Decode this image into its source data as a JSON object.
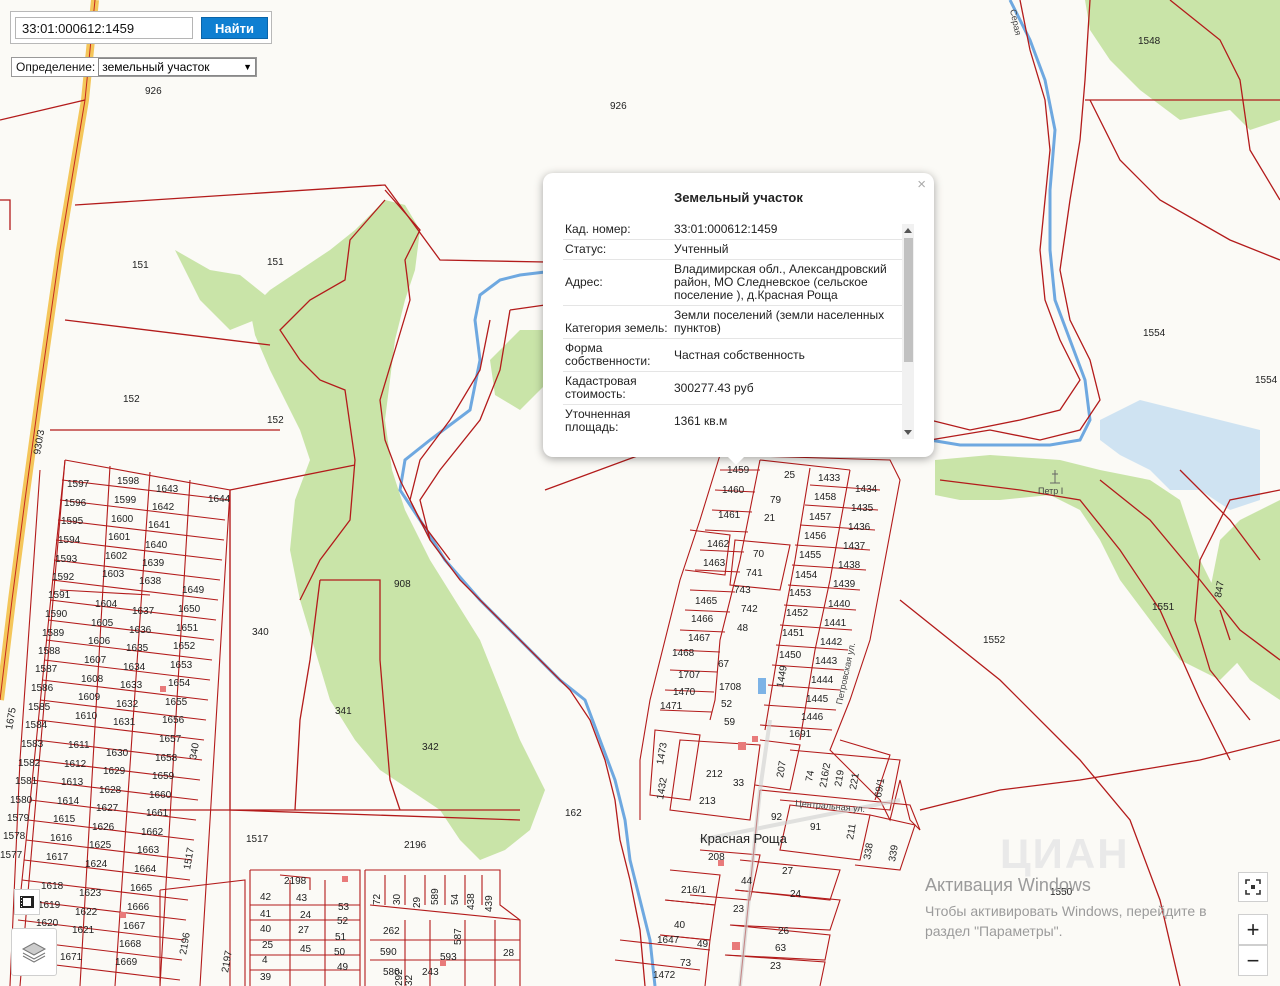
{
  "search": {
    "value": "33:01:000612:1459",
    "button_label": "Найти"
  },
  "definition": {
    "label": "Определение:",
    "selected": "земельный участок"
  },
  "popup": {
    "title": "Земельный участок",
    "close": "×",
    "fields": [
      {
        "key": "Кад. номер:",
        "value": "33:01:000612:1459"
      },
      {
        "key": "Статус:",
        "value": "Учтенный"
      },
      {
        "key": "Адрес:",
        "value": "Владимирская обл., Александровский район, МО Следневское (сельское поселение ), д.Красная Роща"
      },
      {
        "key": "Категория земель:",
        "value": "Земли поселений (земли населенных пунктов)"
      },
      {
        "key": "Форма собственности:",
        "value": "Частная собственность"
      },
      {
        "key": "Кадастровая стоимость:",
        "value": "300277.43 руб"
      },
      {
        "key": "Уточненная площадь:",
        "value": "1361 кв.м"
      }
    ]
  },
  "map": {
    "place_name": "Красная Роща",
    "streets": [
      "Петровская ул.",
      "Центральная ул.",
      "Серая"
    ],
    "parcel_labels": [
      "926",
      "926",
      "1548",
      "151",
      "151",
      "152",
      "152",
      "1554",
      "1554",
      "908",
      "340",
      "341",
      "342",
      "162",
      "1517",
      "2196",
      "2198",
      "1552",
      "1551",
      "847",
      "930/3",
      "1597",
      "1598",
      "1643",
      "1644",
      "1596",
      "1599",
      "1642",
      "1595",
      "1600",
      "1641",
      "1594",
      "1601",
      "1640",
      "1593",
      "1602",
      "1639",
      "1592",
      "1603",
      "1638",
      "1649",
      "1591",
      "1604",
      "1637",
      "1650",
      "1590",
      "1605",
      "1636",
      "1651",
      "1589",
      "1606",
      "1635",
      "1652",
      "1588",
      "1607",
      "1634",
      "1653",
      "1587",
      "1608",
      "1633",
      "1654",
      "1586",
      "1609",
      "1632",
      "1655",
      "1585",
      "1610",
      "1631",
      "1656",
      "1584",
      "1657",
      "1583",
      "1611",
      "1630",
      "1658",
      "1582",
      "1612",
      "1629",
      "1659",
      "1581",
      "1613",
      "1628",
      "1660",
      "1580",
      "1614",
      "1627",
      "1661",
      "1579",
      "1615",
      "1626",
      "1662",
      "1578",
      "1616",
      "1625",
      "1663",
      "1577",
      "1617",
      "1624",
      "1664",
      "1618",
      "1623",
      "1665",
      "1619",
      "1622",
      "1666",
      "1620",
      "1621",
      "1667",
      "1668",
      "1669",
      "1671",
      "1675",
      "1517",
      "2196",
      "2197",
      "1459",
      "25",
      "1433",
      "1434",
      "1460",
      "79",
      "1458",
      "1435",
      "1461",
      "21",
      "1457",
      "1436",
      "1462",
      "1456",
      "1437",
      "70",
      "1455",
      "1438",
      "1463",
      "741",
      "1454",
      "1439",
      "743",
      "1453",
      "1465",
      "742",
      "1440",
      "1452",
      "1466",
      "48",
      "1441",
      "1451",
      "1467",
      "1442",
      "1450",
      "1468",
      "67",
      "1443",
      "1707",
      "1708",
      "1449",
      "1444",
      "1470",
      "52",
      "1445",
      "1471",
      "59",
      "1446",
      "1473",
      "1691",
      "212",
      "207",
      "74",
      "216/2",
      "219",
      "221",
      "69/1",
      "33",
      "1432",
      "213",
      "92",
      "91",
      "211",
      "338",
      "339",
      "208",
      "27",
      "216/1",
      "24",
      "44",
      "23",
      "40",
      "26",
      "1647",
      "63",
      "73",
      "1472",
      "23",
      "42",
      "43",
      "53",
      "41",
      "24",
      "52",
      "40",
      "27",
      "51",
      "45",
      "50",
      "4",
      "49",
      "39",
      "72",
      "30",
      "589",
      "54",
      "438",
      "439",
      "262",
      "587",
      "28",
      "590",
      "593",
      "580",
      "292",
      "243",
      "1550"
    ]
  },
  "attribution": {
    "watermark_title": "Активация Windows",
    "watermark_text_1": "Чтобы активировать Windows, перейдите в",
    "watermark_text_2": "раздел \"Параметры\".",
    "logo_text": "ЦИАН"
  },
  "controls": {
    "zoom_in": "+",
    "zoom_out": "−"
  },
  "colors": {
    "parcel_border": "#b31b1b",
    "forest": "#c7e3a6",
    "water": "#7db3e6",
    "road": "#f2c94c",
    "button": "#0f7fd1"
  }
}
